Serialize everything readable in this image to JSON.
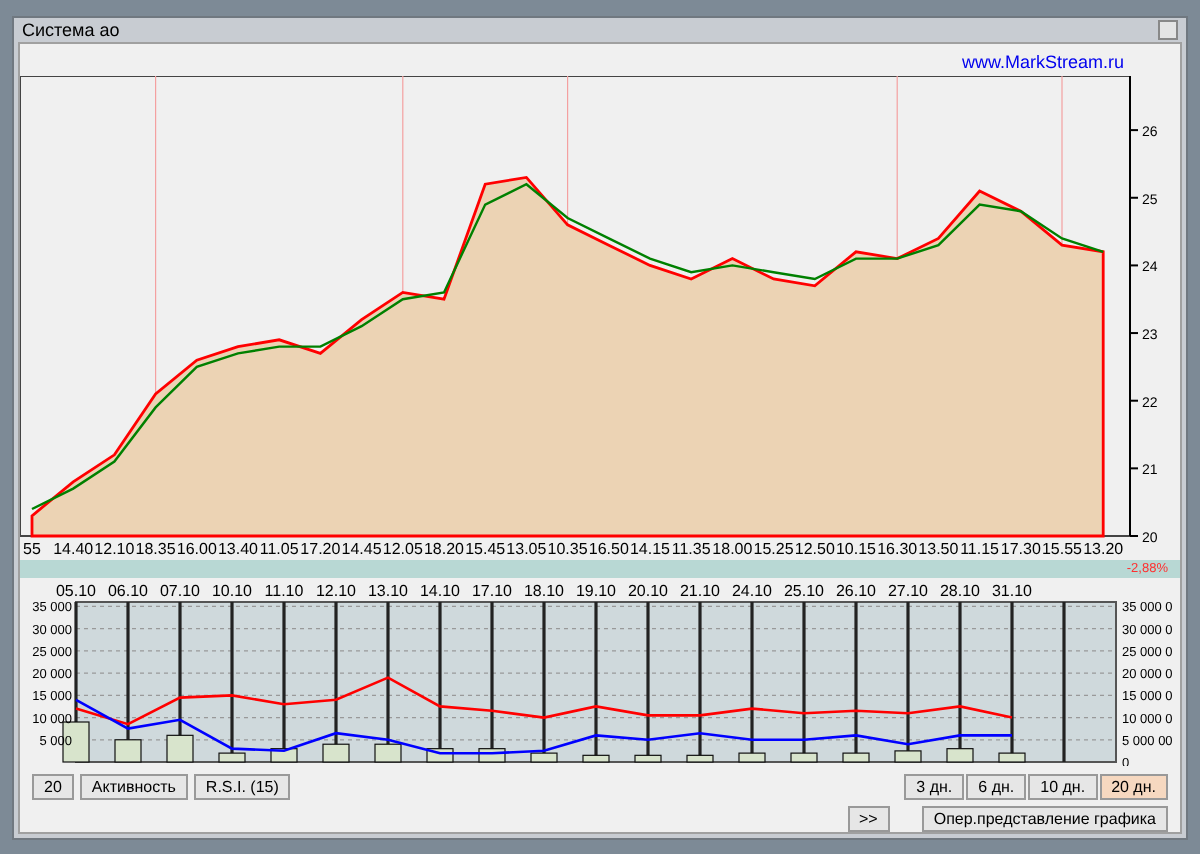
{
  "window": {
    "title": "Система ао"
  },
  "link": "www.MarkStream.ru",
  "price_chart": {
    "chart_data": {
      "type": "area",
      "categories": [
        "55",
        "14.40",
        "12.10",
        "18.35",
        "16.00",
        "13.40",
        "11.05",
        "17.20",
        "14.45",
        "12.05",
        "18.20",
        "15.45",
        "13.05",
        "10.35",
        "16.50",
        "14.15",
        "11.35",
        "18.00",
        "15.25",
        "12.50",
        "10.15",
        "16.30",
        "13.50",
        "11.15",
        "17.30",
        "15.55",
        "13.20"
      ],
      "ylim": [
        20,
        26.8
      ],
      "yticks": [
        20,
        21,
        22,
        23,
        24,
        25,
        26
      ],
      "grid": true,
      "series": [
        {
          "color": "#ff0000",
          "values": [
            20.3,
            20.8,
            21.2,
            22.1,
            22.6,
            22.8,
            22.9,
            22.7,
            23.2,
            23.6,
            23.5,
            25.2,
            25.3,
            24.6,
            24.3,
            24.0,
            23.8,
            24.1,
            23.8,
            23.7,
            24.2,
            24.1,
            24.4,
            25.1,
            24.8,
            24.3,
            24.2
          ]
        },
        {
          "type": "line",
          "color": "#008000",
          "values": [
            20.4,
            20.7,
            21.1,
            21.9,
            22.5,
            22.7,
            22.8,
            22.8,
            23.1,
            23.5,
            23.6,
            24.9,
            25.2,
            24.7,
            24.4,
            24.1,
            23.9,
            24.0,
            23.9,
            23.8,
            24.1,
            24.1,
            24.3,
            24.9,
            24.8,
            24.4,
            24.2
          ]
        }
      ]
    }
  },
  "change": "-2,88%",
  "activity_chart": {
    "chart_data": {
      "type": "line",
      "categories": [
        "05.10",
        "06.10",
        "07.10",
        "10.10",
        "11.10",
        "12.10",
        "13.10",
        "14.10",
        "17.10",
        "18.10",
        "19.10",
        "20.10",
        "21.10",
        "24.10",
        "25.10",
        "26.10",
        "27.10",
        "28.10",
        "31.10"
      ],
      "ylim": [
        0,
        36000
      ],
      "yticks": [
        {
          "value": 5000,
          "label": "5 000"
        },
        {
          "value": 10000,
          "label": "10 000"
        },
        {
          "value": 15000,
          "label": "15 000"
        },
        {
          "value": 20000,
          "label": "20 000"
        },
        {
          "value": 25000,
          "label": "25 000"
        },
        {
          "value": 30000,
          "label": "30 000"
        },
        {
          "value": 35000,
          "label": "35 000"
        }
      ],
      "grid": true,
      "series": [
        {
          "type": "bar",
          "color": "#d8e4cc",
          "values": [
            9000,
            5000,
            6000,
            2000,
            3000,
            4000,
            4000,
            3000,
            3000,
            2000,
            1500,
            1500,
            1500,
            2000,
            2000,
            2000,
            2500,
            3000,
            2000
          ]
        },
        {
          "color": "#ff0000",
          "values": [
            12000,
            8500,
            14500,
            15000,
            13000,
            14000,
            19000,
            12500,
            11500,
            10000,
            12500,
            10500,
            10500,
            12000,
            11000,
            11500,
            11000,
            12500,
            10000
          ]
        },
        {
          "color": "#0000ff",
          "values": [
            14000,
            7500,
            9500,
            3000,
            2500,
            6500,
            5000,
            2000,
            2000,
            2500,
            6000,
            5000,
            6500,
            5000,
            5000,
            6000,
            4000,
            6000,
            6000
          ]
        }
      ]
    },
    "right_axis_labels": [
      "35 000 0",
      "30 000 0",
      "25 000 0",
      "20 000 0",
      "15 000 0",
      "10 000 0",
      "5 000 00",
      "0"
    ]
  },
  "indicator_buttons": [
    "20",
    "Активность",
    "R.S.I.  (15)"
  ],
  "periods": [
    {
      "label": "3 дн.",
      "selected": false
    },
    {
      "label": "6 дн.",
      "selected": false
    },
    {
      "label": "10 дн.",
      "selected": false
    },
    {
      "label": "20 дн.",
      "selected": true
    }
  ],
  "nav_button": ">>",
  "mode_button": "Опер.представление графика"
}
